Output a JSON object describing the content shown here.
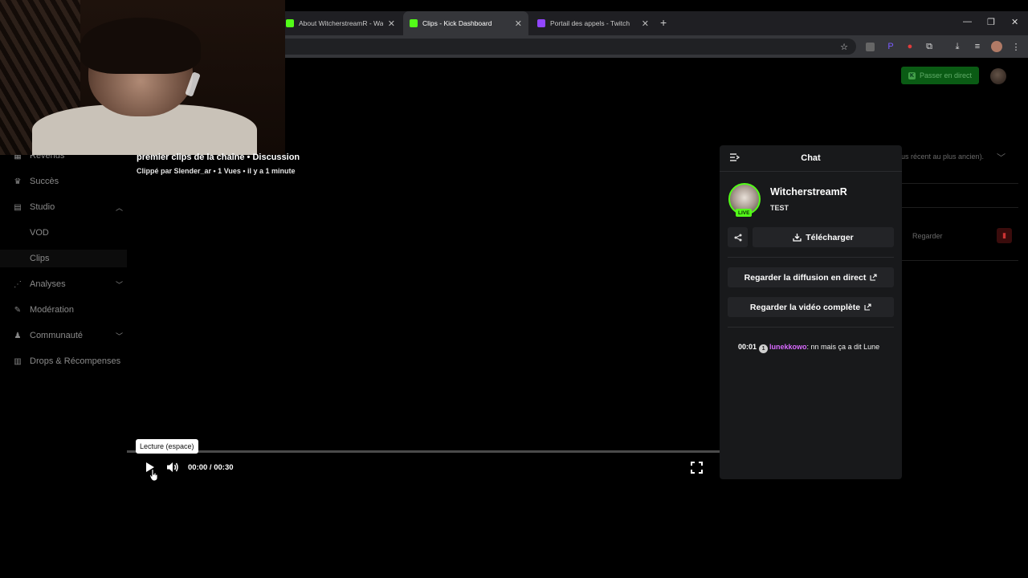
{
  "browser": {
    "tabs": [
      {
        "title": "About WitcherstreamR - Watch",
        "favicon_color": "#53fc18"
      },
      {
        "title": "Clips - Kick Dashboard",
        "favicon_color": "#53fc18"
      },
      {
        "title": "Portail des appels - Twitch",
        "favicon_color": "#9146ff"
      }
    ],
    "active_tab": 1
  },
  "header": {
    "go_live_label": "Passer en direct"
  },
  "sidebar": {
    "items": [
      {
        "label": "Revenus",
        "icon": "chart-icon"
      },
      {
        "label": "Succès",
        "icon": "trophy-icon"
      },
      {
        "label": "Studio",
        "icon": "film-icon"
      },
      {
        "label": "VOD",
        "icon": ""
      },
      {
        "label": "Clips",
        "icon": ""
      },
      {
        "label": "Analyses",
        "icon": "analytics-icon"
      },
      {
        "label": "Modération",
        "icon": "wrench-icon"
      },
      {
        "label": "Communauté",
        "icon": "users-icon"
      },
      {
        "label": "Drops & Récompenses",
        "icon": "gift-icon"
      }
    ]
  },
  "video": {
    "title": "premier clips de la chaîne • Discussion",
    "subtitle": "Clippé par Slender_ar • 1 Vues • il y a 1 minute",
    "tooltip": "Lecture (espace)",
    "time": "00:00 / 00:30",
    "progress": 0
  },
  "background": {
    "sort_text": "us récent au plus ancien).",
    "watch_label": "Regarder"
  },
  "chat": {
    "title": "Chat",
    "channel_name": "WitcherstreamR",
    "channel_sub": "TEST",
    "live_badge": "LIVE",
    "download_label": "Télécharger",
    "watch_live_label": "Regarder la diffusion en direct",
    "watch_full_label": "Regarder la vidéo complète",
    "message": {
      "time": "00:01",
      "badge": "1",
      "user": "lunekkowo",
      "text": ": nn mais ça a dit Lune"
    }
  },
  "colors": {
    "kick_green": "#53fc18",
    "username_purple": "#d96aff",
    "panel_bg": "#18191b"
  }
}
